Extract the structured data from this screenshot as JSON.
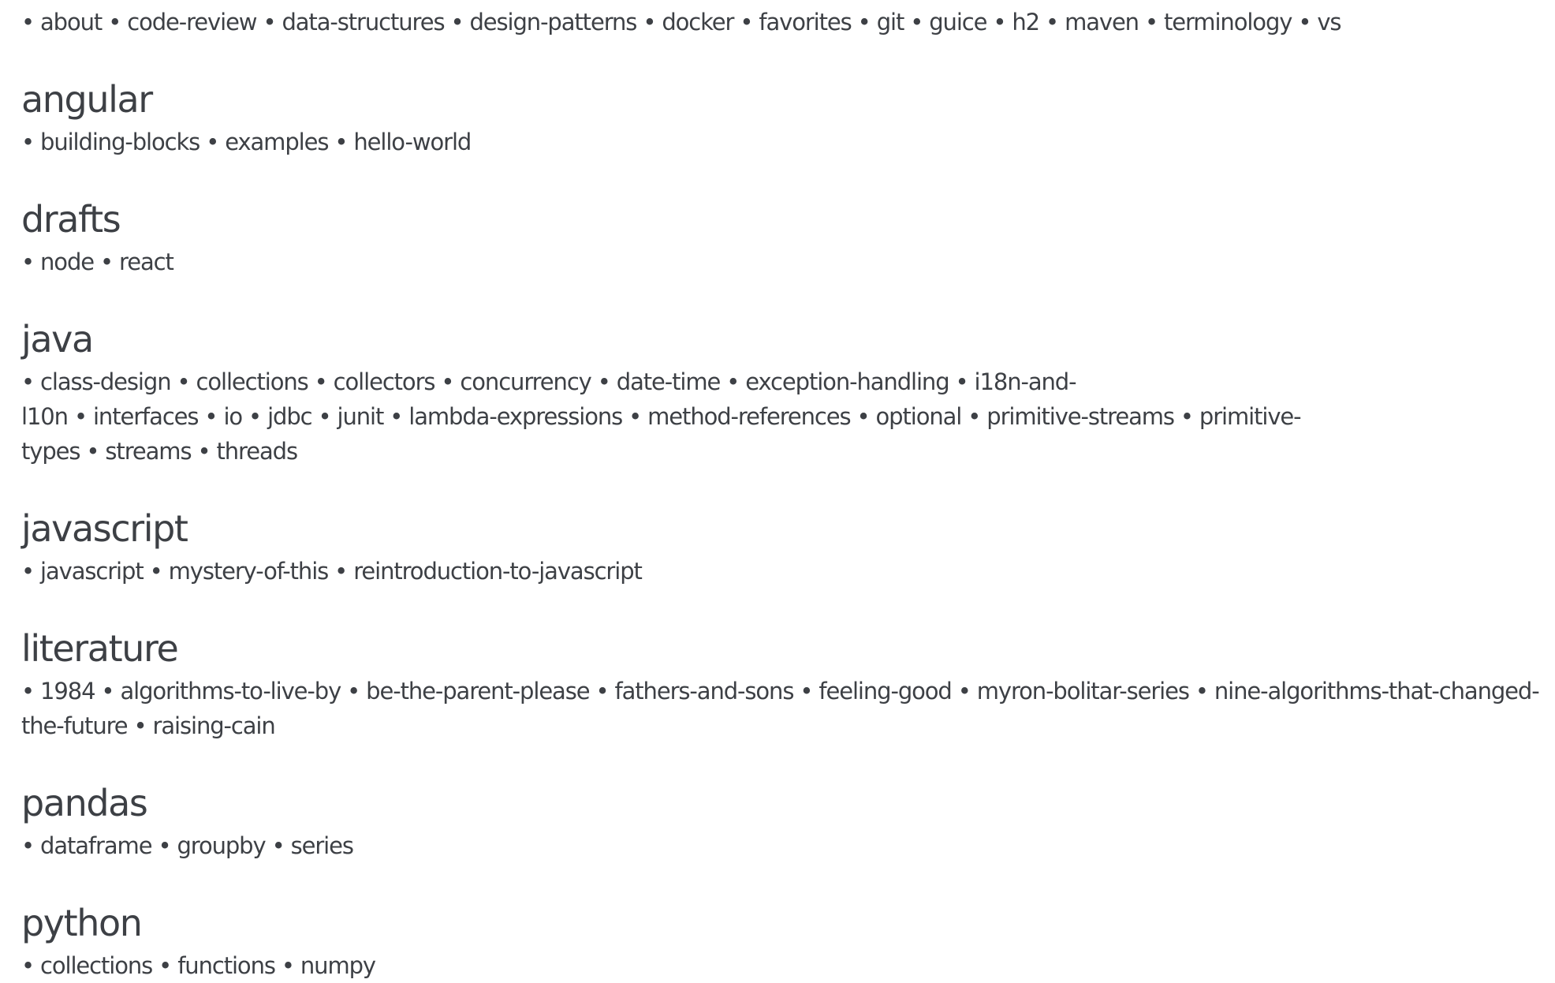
{
  "root_tags": [
    "about",
    "code-review",
    "data-structures",
    "design-patterns",
    "docker",
    "favorites",
    "git",
    "guice",
    "h2",
    "maven",
    "terminology",
    "vs"
  ],
  "bullet_char": "•",
  "sections": [
    {
      "title": "angular",
      "items": [
        "building-blocks",
        "examples",
        "hello-world"
      ]
    },
    {
      "title": "drafts",
      "items": [
        "node",
        "react"
      ]
    },
    {
      "title": "java",
      "items": [
        "class-design",
        "collections",
        "collectors",
        "concurrency",
        "date-time",
        "exception-handling",
        "i18n-and-l10n",
        "interfaces",
        "io",
        "jdbc",
        "junit",
        "lambda-expressions",
        "method-references",
        "optional",
        "primitive-streams",
        "primitive-types",
        "streams",
        "threads"
      ]
    },
    {
      "title": "javascript",
      "items": [
        "javascript",
        "mystery-of-this",
        "reintroduction-to-javascript"
      ]
    },
    {
      "title": "literature",
      "items": [
        "1984",
        "algorithms-to-live-by",
        "be-the-parent-please",
        "fathers-and-sons",
        "feeling-good",
        "myron-bolitar-series",
        "nine-algorithms-that-changed-the-future",
        "raising-cain"
      ]
    },
    {
      "title": "pandas",
      "items": [
        "dataframe",
        "groupby",
        "series"
      ]
    },
    {
      "title": "python",
      "items": [
        "collections",
        "functions",
        "numpy"
      ]
    }
  ]
}
